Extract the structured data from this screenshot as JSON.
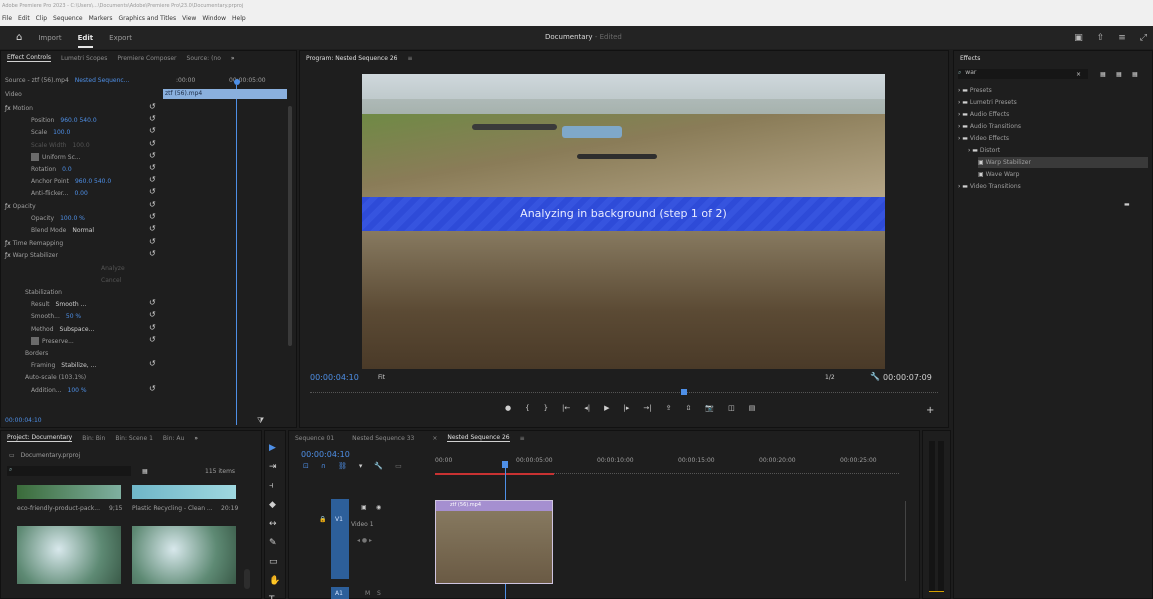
{
  "window": {
    "title": "Adobe Premiere Pro 2023 - C:\\Users\\...\\Documents\\Adobe\\Premiere Pro\\23.0\\Documentary.prproj",
    "menus": [
      "File",
      "Edit",
      "Clip",
      "Sequence",
      "Markers",
      "Graphics and Titles",
      "View",
      "Window",
      "Help"
    ]
  },
  "header": {
    "nav": [
      "Import",
      "Edit",
      "Export"
    ],
    "active": "Edit",
    "project_title": "Documentary",
    "edited_label": "- Edited"
  },
  "effect_controls": {
    "tabs": [
      "Effect Controls",
      "Lumetri Scopes",
      "Premiere Composer",
      "Source: (no"
    ],
    "source_label": "Source - ztf (56).mp4",
    "sequence_label": "Nested Sequenc...",
    "time_start": ":00:00",
    "time_end": "00:00:05:00",
    "clip_label": "ztf (56).mp4",
    "video_header": "Video",
    "rows": [
      {
        "label": "Motion",
        "value": "",
        "kind": "fx"
      },
      {
        "label": "Position",
        "value": "960.0    540.0",
        "kind": "prop"
      },
      {
        "label": "Scale",
        "value": "100.0",
        "kind": "prop"
      },
      {
        "label": "Scale Width",
        "value": "100.0",
        "kind": "dim"
      },
      {
        "label": "Uniform Sc...",
        "value": "",
        "kind": "check"
      },
      {
        "label": "Rotation",
        "value": "0.0",
        "kind": "prop"
      },
      {
        "label": "Anchor Point",
        "value": "960.0    540.0",
        "kind": "prop"
      },
      {
        "label": "Anti-flicker...",
        "value": "0.00",
        "kind": "prop"
      },
      {
        "label": "Opacity",
        "value": "",
        "kind": "fx"
      },
      {
        "label": "Opacity",
        "value": "100.0 %",
        "kind": "prop"
      },
      {
        "label": "Blend Mode",
        "value": "Normal",
        "kind": "select"
      },
      {
        "label": "Time Remapping",
        "value": "",
        "kind": "fx"
      },
      {
        "label": "Warp Stabilizer",
        "value": "",
        "kind": "fx"
      },
      {
        "label": "Analyze",
        "value": "",
        "kind": "button"
      },
      {
        "label": "Cancel",
        "value": "",
        "kind": "button"
      },
      {
        "label": "Stabilization",
        "value": "",
        "kind": "group"
      },
      {
        "label": "Result",
        "value": "Smooth ...",
        "kind": "select"
      },
      {
        "label": "Smooth...",
        "value": "50 %",
        "kind": "prop"
      },
      {
        "label": "Method",
        "value": "Subspace...",
        "kind": "select"
      },
      {
        "label": "Preserve...",
        "value": "",
        "kind": "check"
      },
      {
        "label": "Borders",
        "value": "",
        "kind": "group"
      },
      {
        "label": "Framing",
        "value": "Stabilize, ...",
        "kind": "select"
      },
      {
        "label": "Auto-scale (103.1%)",
        "value": "",
        "kind": "group"
      },
      {
        "label": "Addition...",
        "value": "100 %",
        "kind": "prop"
      }
    ],
    "timecode": "00:00:04:10"
  },
  "program": {
    "tab_label": "Program: Nested Sequence 26",
    "overlay_text": "Analyzing in background (step 1 of 2)",
    "timecode": "00:00:04:10",
    "fit": "Fit",
    "resolution": "1/2",
    "duration": "00:00:07:09"
  },
  "effects": {
    "title": "Effects",
    "search_value": "war",
    "tree": [
      {
        "label": "Presets",
        "level": 0
      },
      {
        "label": "Lumetri Presets",
        "level": 0
      },
      {
        "label": "Audio Effects",
        "level": 0
      },
      {
        "label": "Audio Transitions",
        "level": 0
      },
      {
        "label": "Video Effects",
        "level": 0
      },
      {
        "label": "Distort",
        "level": 1
      },
      {
        "label": "Warp Stabilizer",
        "level": 2,
        "selected": true
      },
      {
        "label": "Wave Warp",
        "level": 2
      },
      {
        "label": "Video Transitions",
        "level": 0
      }
    ]
  },
  "project": {
    "tabs": [
      "Project: Documentary",
      "Bin: Bin",
      "Bin: Scene 1",
      "Bin: Au"
    ],
    "file": "Documentary.prproj",
    "item_count": "115 items",
    "clips": [
      {
        "name": "eco-friendly-product-pack...",
        "duration": "9;15"
      },
      {
        "name": "Plastic Recycling - Clean ...",
        "duration": "20:19"
      }
    ]
  },
  "timeline": {
    "tabs": [
      "Sequence 01",
      "Nested Sequence 33",
      "Nested Sequence 26"
    ],
    "active_tab": "Nested Sequence 26",
    "timecode": "00:00:04:10",
    "ruler": [
      "00:00",
      "00:00:05:00",
      "00:00:10:00",
      "00:00:15:00",
      "00:00:20:00",
      "00:00:25:00"
    ],
    "video_track": "V1",
    "video_label": "Video 1",
    "audio_track": "A1",
    "clip_name": "ztf (56).mp4"
  }
}
